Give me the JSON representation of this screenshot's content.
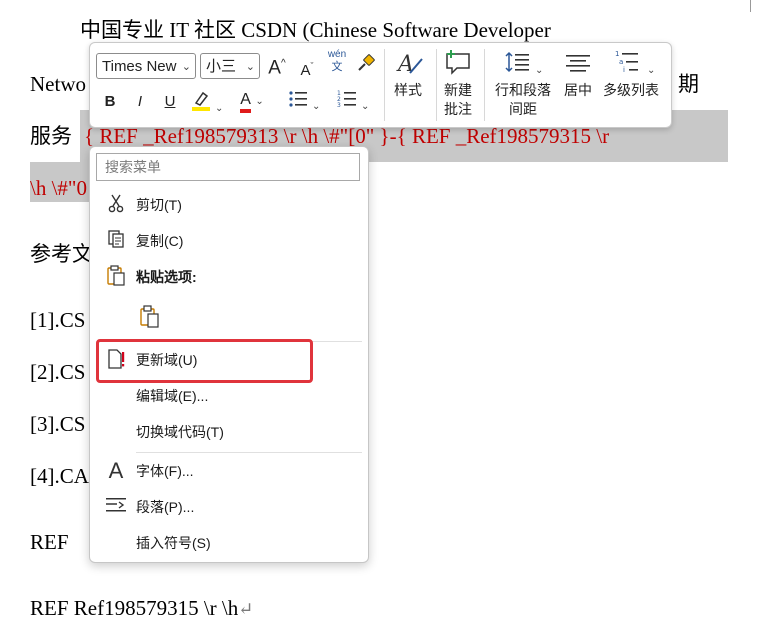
{
  "document": {
    "line1": "中国专业 IT 社区 CSDN (Chinese Software Developer",
    "line2_start": "Netwo",
    "line2_end": "期",
    "line3_prefix": "服务",
    "line3_field": "{ REF _Ref198579313 \\r \\h \\#\"[0\" }-{ REF _Ref198579315 \\r",
    "line4_field": "\\h \\#\"0",
    "line5": "参考文",
    "ref1": "[1].CS",
    "ref2": "[2].CS",
    "ref3": "[3].CS",
    "ref4": "[4].CA",
    "line_ref": "REF",
    "last_line": "REF  Ref198579315 \\r \\h",
    "pilcrow": "↵"
  },
  "toolbar": {
    "font_name": "Times New",
    "font_size": "小三",
    "grow_font": "A",
    "shrink_font": "A",
    "phonetic_top": "wén",
    "phonetic_bottom": "文",
    "bold": "B",
    "italic": "I",
    "underline": "U",
    "font_color_letter": "A",
    "styles_label": "样式",
    "new_comment_label_1": "新建",
    "new_comment_label_2": "批注",
    "line_spacing_label_1": "行和段落",
    "line_spacing_label_2": "间距",
    "center_label": "居中",
    "multilevel_label": "多级列表",
    "colors": {
      "highlight": "#ffe600",
      "font_color": "#e01b1b",
      "accent_green": "#2d9d4f"
    }
  },
  "context_menu": {
    "search_placeholder": "搜索菜单",
    "items": [
      {
        "label": "剪切(T)",
        "icon": "scissors-icon"
      },
      {
        "label": "复制(C)",
        "icon": "copy-icon"
      },
      {
        "label": "粘贴选项:",
        "icon": "paste-icon"
      },
      {
        "label": "更新域(U)",
        "icon": "update-field-icon"
      },
      {
        "label": "编辑域(E)...",
        "icon": ""
      },
      {
        "label": "切换域代码(T)",
        "icon": ""
      },
      {
        "label": "字体(F)...",
        "icon": "font-icon"
      },
      {
        "label": "段落(P)...",
        "icon": "paragraph-icon"
      },
      {
        "label": "插入符号(S)",
        "icon": ""
      }
    ],
    "highlight_color": "#e0343c"
  }
}
